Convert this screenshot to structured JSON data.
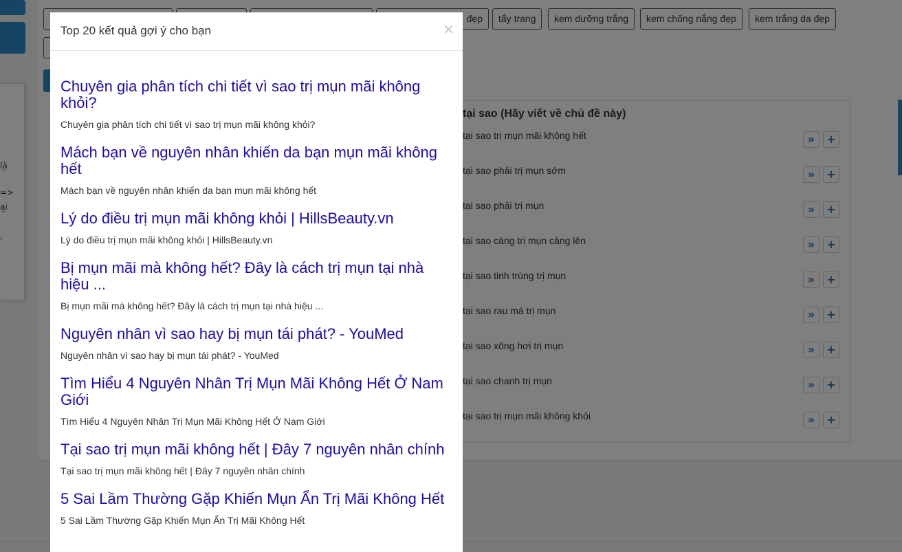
{
  "background": {
    "tags": [
      "đẹp",
      "tẩy trang",
      "kem dưỡng trắng",
      "kem chống nắng đẹp",
      "kem trắng da đẹp"
    ],
    "left_fragments": [
      "là",
      "=>",
      "ai",
      ","
    ],
    "suggestions": {
      "title": "tại sao (Hãy viết về chủ đề này)",
      "items": [
        "tại sao trị mụn mãi không hết",
        "tại sao phải trị mụn sớm",
        "tại sao phải trị mụn",
        "tại sao càng trị mụn càng lên",
        "tại sao tinh trùng trị mụn",
        "tại sao rau má trị mụn",
        "tại sao xông hơi trị mụn",
        "tại sao chanh trị mụn",
        "tại sao trị mụn mãi không khỏi"
      ],
      "arrow_glyph": "»",
      "plus_glyph": "+"
    }
  },
  "modal": {
    "title": "Top 20 kết quả gợi ý cho bạn",
    "close_glyph": "×",
    "results": [
      {
        "title": "Chuyên gia phân tích chi tiết vì sao trị mụn mãi không khỏi?",
        "desc": "Chuyên gia phân tích chi tiết vì sao trị mụn mãi không khỏi?"
      },
      {
        "title": "Mách bạn về nguyên nhân khiến da bạn mụn mãi không hết",
        "desc": "Mách bạn về nguyên nhân khiến da bạn mụn mãi không hết"
      },
      {
        "title": "Lý do điều trị mụn mãi không khỏi | HillsBeauty.vn",
        "desc": "Lý do điều trị mụn mãi không khỏi | HillsBeauty.vn"
      },
      {
        "title": "Bị mụn mãi mà không hết? Đây là cách trị mụn tại nhà hiệu ...",
        "desc": "Bị mụn mãi mà không hết? Đây là cách trị mụn tại nhà hiệu ..."
      },
      {
        "title": "Nguyên nhân vì sao hay bị mụn tái phát? - YouMed",
        "desc": "Nguyên nhân vì sao hay bị mụn tái phát? - YouMed"
      },
      {
        "title": "Tìm Hiểu 4 Nguyên Nhân Trị Mụn Mãi Không Hết Ở Nam Giới",
        "desc": "Tìm Hiểu 4 Nguyên Nhân Trị Mụn Mãi Không Hết Ở Nam Giới"
      },
      {
        "title": "Tại sao trị mụn mãi không hết | Đây 7 nguyên nhân chính",
        "desc": "Tại sao trị mụn mãi không hết | Đây 7 nguyên nhân chính"
      },
      {
        "title": "5 Sai Lầm Thường Gặp Khiến Mụn Ẩn Trị Mãi Không Hết",
        "desc": "5 Sai Lầm Thường Gặp Khiến Mụn Ẩn Trị Mãi Không Hết"
      }
    ]
  },
  "colors": {
    "link": "#1a0dab",
    "accent": "#2d8bc9",
    "overlay": "rgba(0,0,0,0.5)"
  }
}
